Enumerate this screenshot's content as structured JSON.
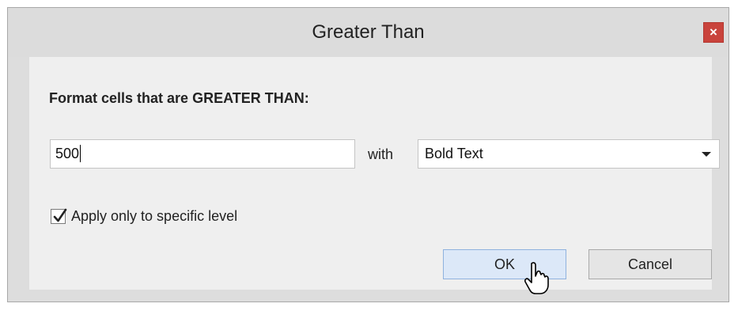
{
  "dialog": {
    "title": "Greater Than",
    "close_label": "×"
  },
  "form": {
    "heading": "Format cells that are GREATER THAN:",
    "value": "500",
    "with_label": "with",
    "format_selected": "Bold Text",
    "checkbox_label": "Apply only to specific level",
    "checkbox_checked": true
  },
  "buttons": {
    "ok_label": "OK",
    "cancel_label": "Cancel"
  }
}
